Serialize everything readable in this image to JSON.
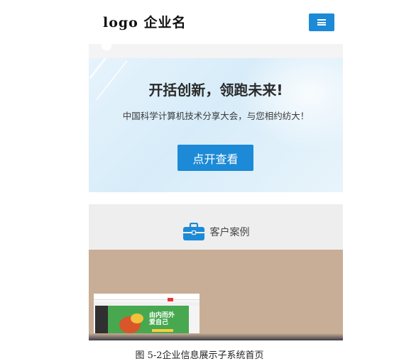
{
  "header": {
    "logo_text": "logo 企业名",
    "menu_icon": "hamburger-menu-icon",
    "accent": "#1c8ad6"
  },
  "banner": {
    "title": "开括创新，领跑未来!",
    "subtitle": "中国科学计算机技术分享大会，与您相约纺大！",
    "button_label": "点开查看"
  },
  "cases": {
    "icon": "briefcase-icon",
    "label": "客户案例"
  },
  "showcase": {
    "thumbnail_text": "由内而外\n爱自己"
  },
  "caption": "图 5-2企业信息展示子系统首页"
}
